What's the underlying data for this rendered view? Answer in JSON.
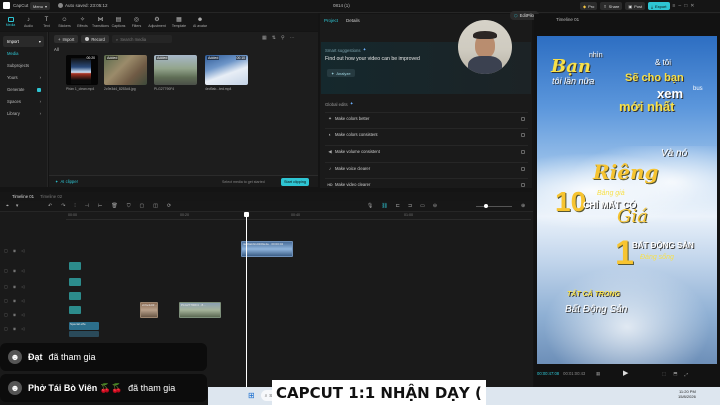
{
  "topbar": {
    "logo": "CapCut",
    "menu": "Menu",
    "autosave": "Auto saved: 23:05:12",
    "project_title": "0814 (1)",
    "pro": "Pro",
    "share": "Share",
    "post": "Post",
    "export": "Export"
  },
  "toolbar": {
    "tools": [
      "Media",
      "Audio",
      "Text",
      "Stickers",
      "Effects",
      "Transitions",
      "Captions",
      "Filters",
      "Adjustment",
      "Template",
      "AI avatar"
    ]
  },
  "sidebar": {
    "items": [
      "Import",
      "Media",
      "Subprojects",
      "Yours",
      "Generate",
      "Spaces",
      "Library"
    ]
  },
  "media": {
    "import_label": "Import",
    "record_label": "Record",
    "search_placeholder": "Search media",
    "all_label": "All",
    "thumbs": [
      {
        "added": "",
        "duration": "00:20",
        "name": "Phần 1_clean.mp4"
      },
      {
        "added": "Added",
        "duration": "",
        "name": "2c9e3d4_8253d4.jpg"
      },
      {
        "added": "Added",
        "duration": "",
        "name": "PLG27790F4"
      },
      {
        "added": "Added",
        "duration": "00:10",
        "name": "4ed9ab...ted.mp4"
      }
    ],
    "ai_clipper": "AI clipper",
    "select_hint": "Select media to get started",
    "start_clipping": "Start clipping"
  },
  "details": {
    "tab_project": "Project",
    "tab_details": "Details",
    "editpilot": "EditPilot",
    "smart_title": "Smart suggestions",
    "smart_desc": "Find out how your video can be improved",
    "analyze": "Analyze",
    "global_edits": "Global edits",
    "edits": [
      {
        "icon": "✦",
        "label": "Make colors better"
      },
      {
        "icon": "◐",
        "label": "Make colors consistent"
      },
      {
        "icon": "◀",
        "label": "Make volume consistent"
      },
      {
        "icon": "♪",
        "label": "Make voice clearer"
      },
      {
        "icon": "HD",
        "label": "Make video clearer"
      }
    ]
  },
  "player": {
    "title": "Timeline 01",
    "time_current": "00:00:47:08",
    "time_total": "00:01:00:43",
    "overlay": {
      "l1a": "Bạn",
      "l1b": "nhìn",
      "l2": "tôi lần nữa",
      "l3a": "& tôi",
      "l3b": "Sẽ cho bạn",
      "l4": "xem",
      "l4b": "bus",
      "l5": "mới nhất",
      "l6": "Và nó",
      "l7": "Riêng",
      "l8a": "10",
      "l8b": "Bảng giá",
      "l9": "CHỈ MẤT CÓ",
      "l10": "Giá",
      "l11": "1",
      "l12": "BẤT ĐỘNG SẢN",
      "l13": "Đáng sống",
      "l14": "TẤT CẢ TRONG",
      "l15": "Bất Động Sản"
    }
  },
  "timeline": {
    "tab1": "Timeline 01",
    "tab2": "Timeline 02",
    "ruler": [
      "00:00",
      "00:20",
      "00:40",
      "01:00"
    ],
    "clip_top": "4ed9ab9cd4fd9e4a · 00:00:04",
    "clip_mid1": "2c9e3d4f...",
    "clip_mid2": "PLG27790F4 · 8...",
    "clip_special": "Special effe"
  },
  "chat": [
    {
      "name": "Đạt",
      "action": "đã tham gia"
    },
    {
      "name": "Phở Tái Bò Viên 🍒🍒",
      "action": "đã tham gia"
    }
  ],
  "banner": "CAPCUT 1:1   NHẬN DẠY (",
  "taskbar": {
    "search": "Search",
    "time": "11:20 PM",
    "date": "15/8/2026"
  }
}
